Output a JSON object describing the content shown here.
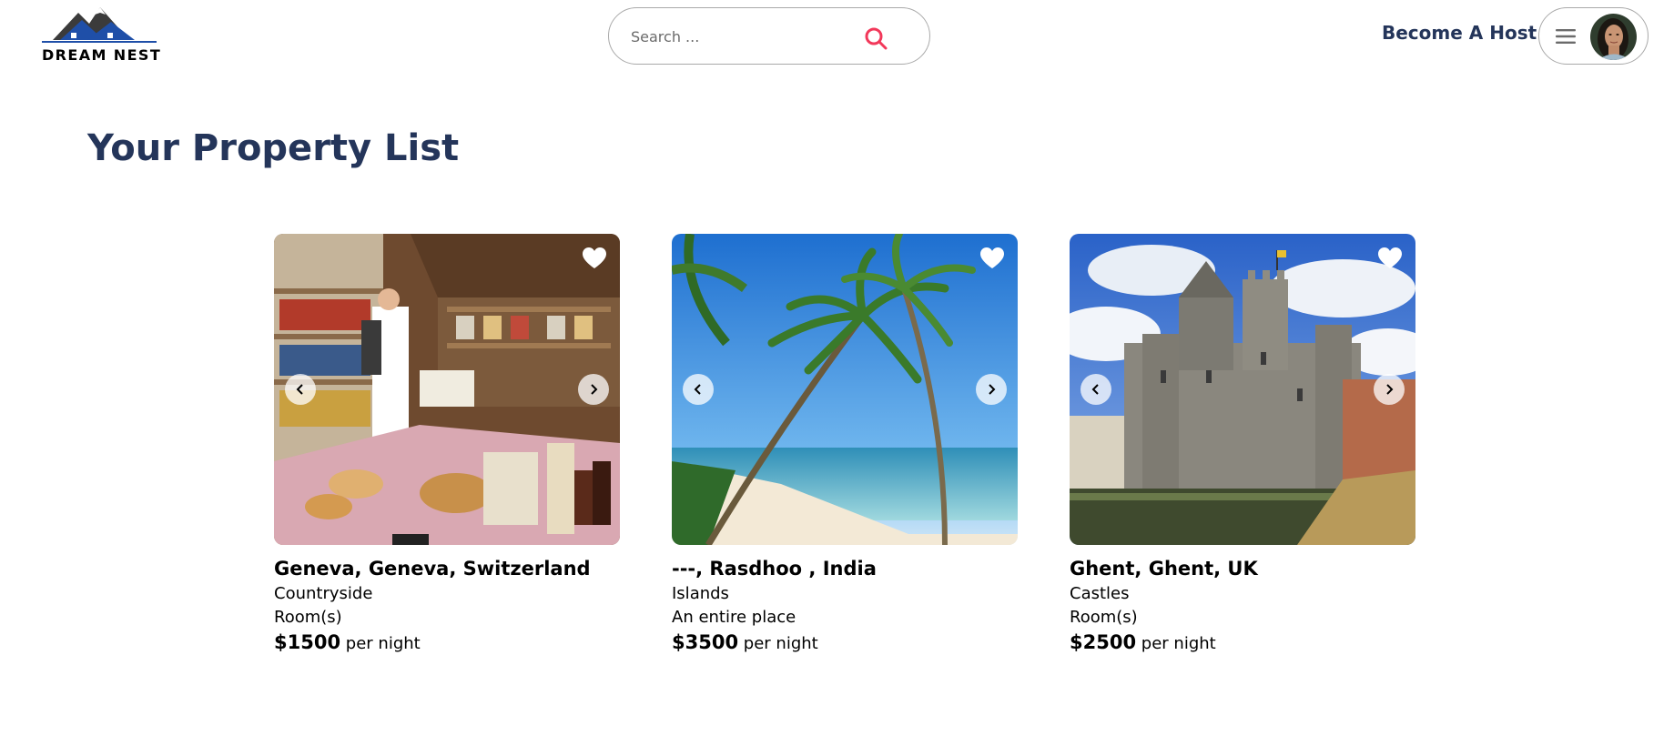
{
  "header": {
    "logo_text": "DREAM NEST",
    "search_placeholder": "Search ...",
    "become_host_label": "Become A Host"
  },
  "page_title": "Your Property List",
  "listings": [
    {
      "location": "Geneva, Geneva, Switzerland",
      "category": "Countryside",
      "type": "Room(s)",
      "price": "$1500",
      "price_suffix": "per night",
      "scene": "bakery"
    },
    {
      "location": "---, Rasdhoo , India",
      "category": "Islands",
      "type": "An entire place",
      "price": "$3500",
      "price_suffix": "per night",
      "scene": "beach"
    },
    {
      "location": "Ghent, Ghent, UK",
      "category": "Castles",
      "type": "Room(s)",
      "price": "$2500",
      "price_suffix": "per night",
      "scene": "castle"
    }
  ],
  "colors": {
    "brand_navy": "#24355a",
    "search_accent": "#f2385a",
    "border": "#a9a9a9"
  },
  "icons": {
    "search": "search-icon",
    "menu": "hamburger-menu-icon",
    "favorite": "heart-icon",
    "prev": "chevron-left-icon",
    "next": "chevron-right-icon"
  }
}
